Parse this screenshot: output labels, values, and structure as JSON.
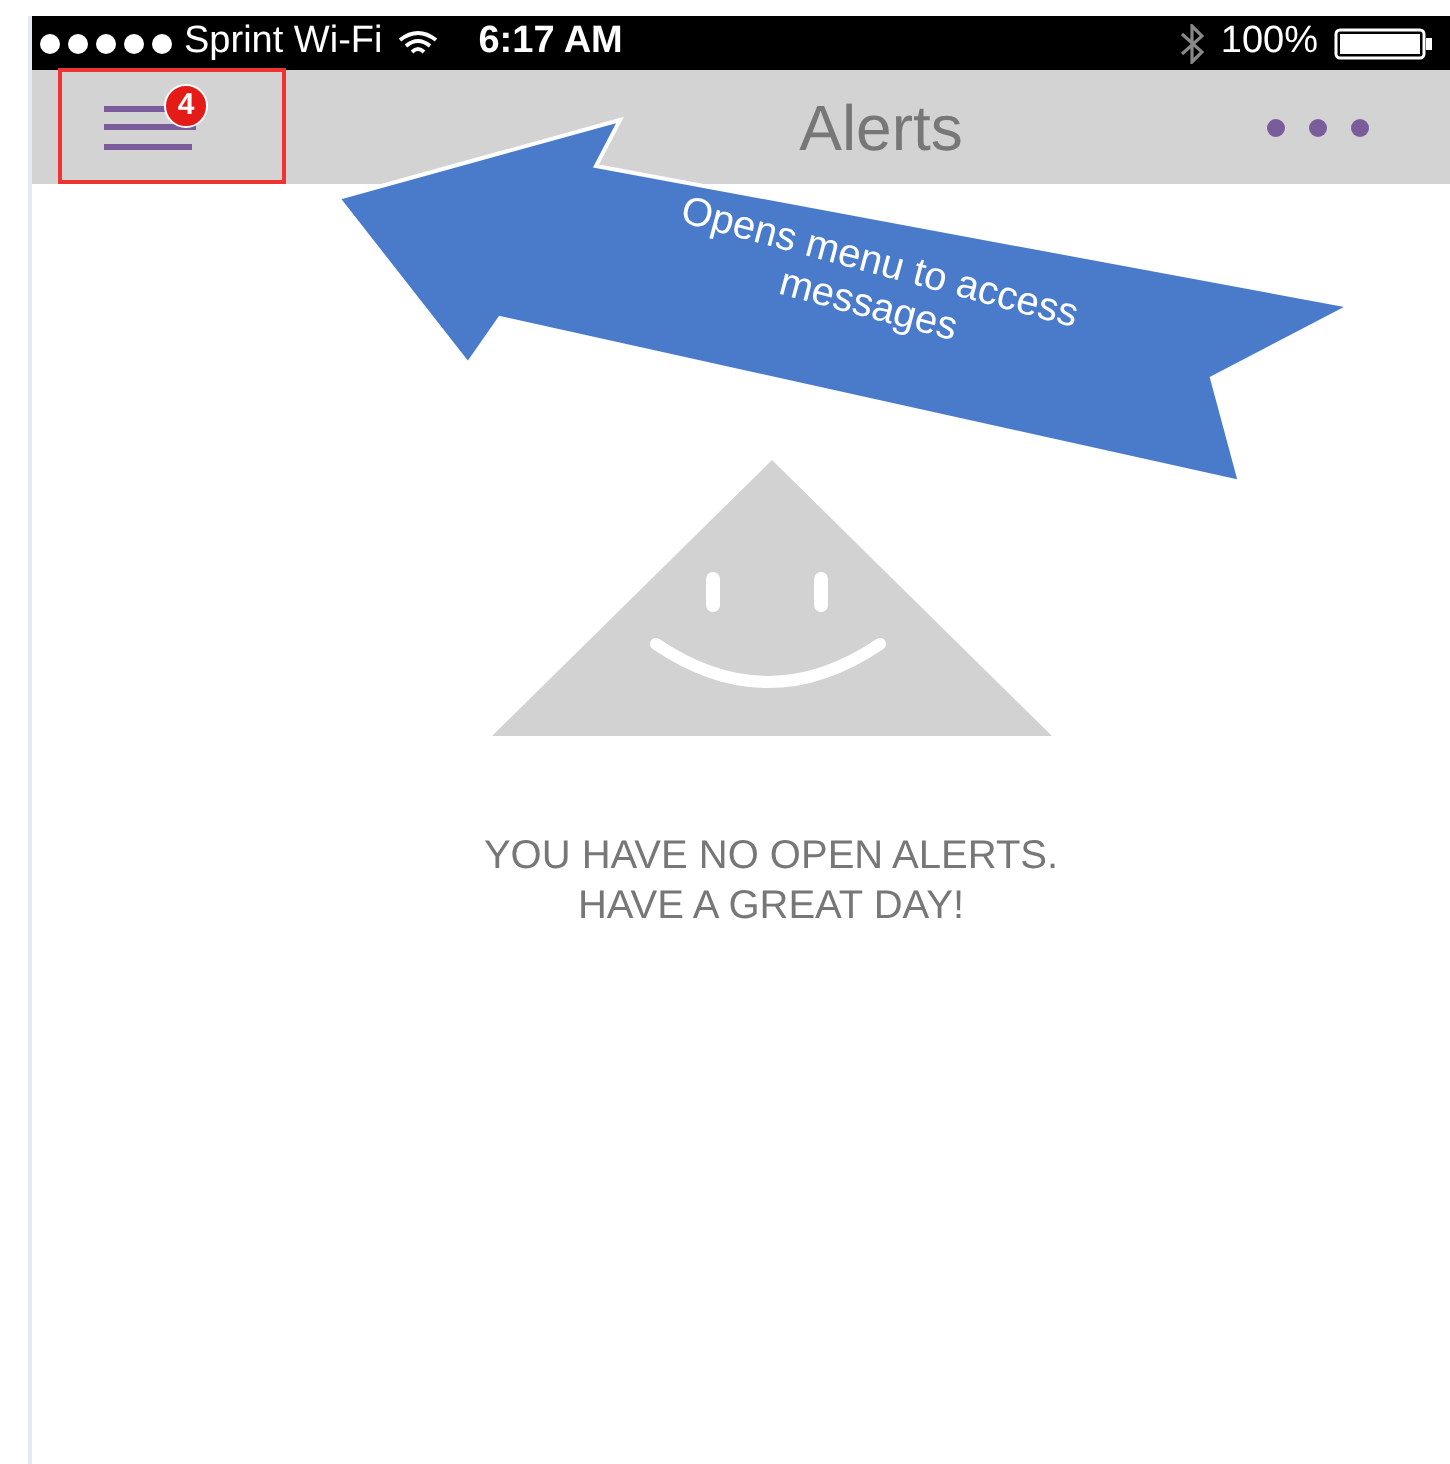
{
  "status_bar": {
    "carrier": "Sprint Wi-Fi",
    "time": "6:17 AM",
    "battery": "100%"
  },
  "header": {
    "badge": "4",
    "title": "Alerts"
  },
  "annotation": {
    "text": "Opens menu to access messages"
  },
  "empty_state": {
    "lines": [
      "YOU HAVE NO OPEN ALERTS.",
      "HAVE A GREAT DAY!"
    ]
  }
}
